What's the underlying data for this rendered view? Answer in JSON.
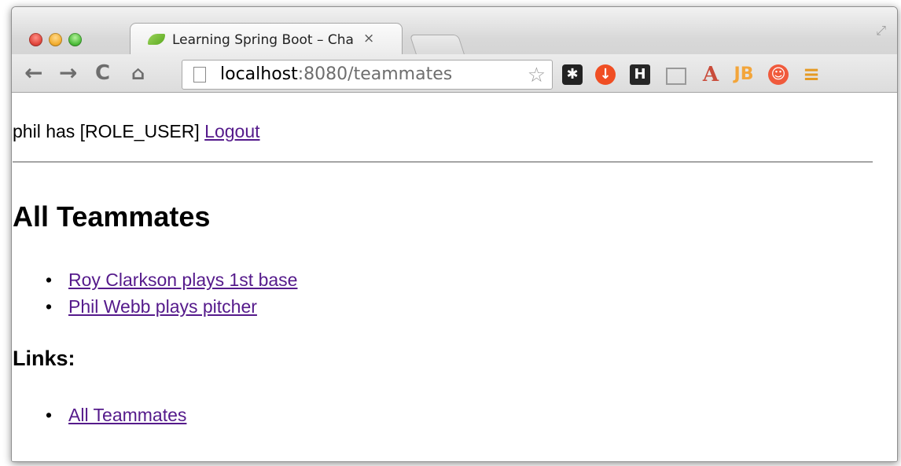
{
  "browser": {
    "tab_title": "Learning Spring Boot – Cha",
    "tab_close": "×",
    "url_host": "localhost",
    "url_path": ":8080/teammates",
    "icons": [
      "back-arrow-icon",
      "forward-arrow-icon",
      "reload-icon",
      "home-icon",
      "page-icon",
      "bookmark-star-icon",
      "menu-icon"
    ]
  },
  "page": {
    "user_text": "phil has [ROLE_USER]",
    "logout_label": "Logout",
    "heading": "All Teammates",
    "teammates": [
      "Roy Clarkson plays 1st base",
      "Phil Webb plays pitcher"
    ],
    "links_heading": "Links:",
    "links": [
      "All Teammates"
    ]
  },
  "colors": {
    "link": "#551a8b",
    "divider": "#a5a5a5"
  }
}
